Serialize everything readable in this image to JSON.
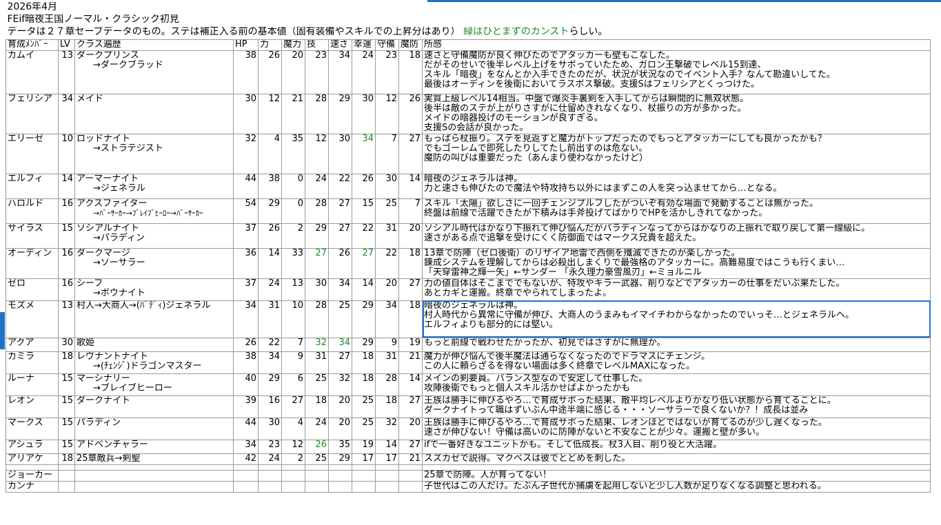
{
  "sheet": {
    "date": "2026年4月",
    "title": "FEif暗夜王国ノーマル・クラシック初見",
    "note_main": "データは２７章セーブデータのもの。ステは補正入る前の基本値（固有装備やスキルでの上昇分はあり）",
    "note_green": "緑はひとまずのカンスト",
    "note_tail": "らしい。"
  },
  "headers": [
    "育成ﾒﾝﾊﾞｰ",
    "LV",
    "クラス遍歴",
    "HP",
    "力",
    "魔力",
    "技",
    "速さ",
    "幸運",
    "守備",
    "魔防",
    "所感"
  ],
  "rows": [
    {
      "name": "カムイ",
      "lv": "13",
      "cls1": "ダークプリンス",
      "cls2": "→ダークブラッド",
      "stats": [
        "38",
        "26",
        "20",
        "23",
        "34",
        "24",
        "23",
        "18"
      ],
      "green": [],
      "comment": [
        "速さと守備魔防が良く伸びたのでアタッカーも壁もこなした。",
        "だがそのせいで後半レベル上げをサボっていたため、ガロン王撃破でレベル15到達、",
        "スキル「暗夜」をなんとか入手できたのだが、状況が状況なのでイベント入手？なんて勘違いしてた。",
        "最後はオーディンを後衛においてラスボス撃破。支援Sはフェリシアとくっつけた。"
      ]
    },
    {
      "name": "フェリシア",
      "lv": "34",
      "cls1": "メイド",
      "cls2": "",
      "stats": [
        "30",
        "12",
        "21",
        "28",
        "29",
        "30",
        "12",
        "26"
      ],
      "green": [],
      "comment": [
        "実質上級レベル14相当。中盤で爆炎手裏剣を入手してからは瞬間的に無双状態。",
        "後半は敵のステが上がりさすがに仕留めきれなくなり、杖振りの方が多かった。",
        "メイドの暗器投げのモーションが良すぎる。",
        "支援Sの会話が良かった。"
      ]
    },
    {
      "name": "エリーゼ",
      "lv": "10",
      "cls1": "ロッドナイト",
      "cls2": "→ストラテジスト",
      "stats": [
        "32",
        "4",
        "35",
        "12",
        "30",
        "34",
        "7",
        "27"
      ],
      "green": [
        5
      ],
      "comment": [
        "もっぱら杖振り。ステを見返すと魔力がトップだったのでもっとアタッカーにしても良かったかも？",
        "でもゴーレムで即死したりしてたし前出すのは危ない。",
        "魔防の叫びは重要だった（あんまり使わなかったけど）"
      ]
    },
    {
      "name": "エルフィ",
      "lv": "14",
      "cls1": "アーマーナイト",
      "cls2": "→ジェネラル",
      "stats": [
        "44",
        "38",
        "0",
        "24",
        "22",
        "26",
        "30",
        "14"
      ],
      "green": [],
      "comment": [
        "暗夜のジェネラルは神。",
        "力と速さも伸びたので魔法や特攻持ち以外にはまずこの人を突っ込ませてから…となる。"
      ]
    },
    {
      "name": "ハロルド",
      "lv": "16",
      "cls1": "アクスファイター",
      "cls2": "→ﾊﾞｰｻｰｶｰ→ﾌﾞﾚｲﾌﾞﾋｰﾛｰ→ﾊﾞｰｻｰｶｰ",
      "cls2small": true,
      "stats": [
        "54",
        "29",
        "0",
        "28",
        "27",
        "15",
        "25",
        "7"
      ],
      "green": [],
      "comment": [
        "スキル「太陽」欲しさに一回チェンジプルフしたがついぞ有効な場面で発動することは無かった。",
        "終盤は前線で活躍できたが下積みは手斧投げてばかりでHPを活かしきれてなかった。"
      ]
    },
    {
      "name": "サイラス",
      "lv": "15",
      "cls1": "ソシアルナイト",
      "cls2": "→パラディン",
      "stats": [
        "37",
        "26",
        "2",
        "29",
        "27",
        "22",
        "31",
        "20"
      ],
      "green": [],
      "comment": [
        "ソシアル時代はかなり下振れて伸び悩んだがパラディンなってからはかなりの上振れで取り戻して第一線級に。",
        "速さがある点で追撃を受けにくく防御面ではマークス兄貴を超えた。"
      ]
    },
    {
      "name": "オーディン",
      "lv": "16",
      "cls1": "ダークマージ",
      "cls2": "→ソーサラー",
      "stats": [
        "36",
        "14",
        "33",
        "27",
        "26",
        "27",
        "22",
        "18"
      ],
      "green": [
        3,
        5
      ],
      "comment": [
        "13章で防陣（ゼロ後衛）のリザイア地雷で西側を殲滅できたのが楽しかった。",
        "錬成システムを理解してからは必殺出しまくりで最強格のアタッカーに。高難易度ではこうも行くまい…",
        "「天穿雷神之輝一矢」←サンダー 「永久理力豪雪風刃」←ミョルニル"
      ]
    },
    {
      "name": "ゼロ",
      "lv": "16",
      "cls1": "シーフ",
      "cls2": "→ボウナイト",
      "stats": [
        "37",
        "24",
        "13",
        "30",
        "34",
        "14",
        "20",
        "27"
      ],
      "green": [],
      "comment": [
        "力の値自体はそこまででもないが、特攻やキラー武器、削りなどでアタッカーの仕事をだいぶ果たした。",
        "あとカギと運搬。終章でやられてしまったよ。"
      ]
    },
    {
      "name": "モズメ",
      "lv": "13",
      "cls1": "村人→大商人→(ﾊﾞﾃﾞｨ)ジェネラル",
      "cls2": "",
      "stats": [
        "34",
        "31",
        "10",
        "28",
        "25",
        "29",
        "34",
        "18"
      ],
      "green": [],
      "selected": true,
      "comment": [
        "暗夜のジェネラルは神。",
        "村人時代から異常に守備が伸び、大商人のうまみもイマイチわからなかったのでいっそ…とジェネラルへ。",
        "エルフィよりも部分的には堅い。"
      ]
    },
    {
      "name": "アクア",
      "lv": "30",
      "cls1": "歌姫",
      "cls2": "",
      "stats": [
        "26",
        "22",
        "7",
        "32",
        "34",
        "29",
        "9",
        "19"
      ],
      "green": [
        3,
        4
      ],
      "comment": [
        "もっと前線で戦わせたかったが、初見ではさすがに無理か。"
      ]
    },
    {
      "name": "カミラ",
      "lv": "18",
      "cls1": "レヴナントナイト",
      "cls2": "→(ﾁｪﾝｼﾞ)ドラゴンマスター",
      "stats": [
        "38",
        "34",
        "9",
        "31",
        "27",
        "18",
        "31",
        "21"
      ],
      "green": [],
      "comment": [
        "魔力が伸び悩んで後半魔法は通らなくなったのでドラマスにチェンジ。",
        "この人に頼らざるを得ない場面は多く終章でレベルMAXになった。"
      ]
    },
    {
      "name": "ルーナ",
      "lv": "15",
      "cls1": "マーシナリー",
      "cls2": "→ブレイブヒーロー",
      "stats": [
        "40",
        "29",
        "6",
        "25",
        "32",
        "18",
        "28",
        "14"
      ],
      "green": [],
      "comment": [
        "メインの剣要員。バランス型なので安定して仕事した。",
        "攻陣後衛でもっと個人スキル活かせばよかったかも"
      ]
    },
    {
      "name": "レオン",
      "lv": "15",
      "cls1": "ダークナイト",
      "cls2": "",
      "stats": [
        "39",
        "16",
        "27",
        "18",
        "20",
        "25",
        "18",
        "27"
      ],
      "green": [],
      "comment": [
        "王族は勝手に伸びるやろ…で育成サボった結果、敵平均レベルよりかなり低い状態から育てることに。",
        "ダークナイトって職はずいぶん中途半端に感じる・・・ソーサラーで良くないか？！成長は並み"
      ]
    },
    {
      "name": "マークス",
      "lv": "15",
      "cls1": "パラディン",
      "cls2": "",
      "stats": [
        "44",
        "30",
        "4",
        "24",
        "20",
        "25",
        "32",
        "20"
      ],
      "green": [],
      "comment": [
        "王族は勝手に伸びるやろ…で育成サボった結果、レオンほどではないが育てるのが少し遅くなった。",
        "速さが伸びない！守備は高いのに防陣がないと不安なことが少々。運搬と壁が多い。"
      ]
    },
    {
      "name": "アシュラ",
      "lv": "15",
      "cls1": "アドベンチャラー",
      "cls2": "",
      "stats": [
        "34",
        "23",
        "12",
        "26",
        "35",
        "19",
        "14",
        "27"
      ],
      "green": [
        3
      ],
      "comment": [
        "ifで一番好きなユニットかも。そして低成長。杖3人目、削り役と大活躍。"
      ]
    },
    {
      "name": "アリアケ",
      "lv": "18",
      "cls1": "25章敵兵→剣聖",
      "cls2": "",
      "stats": [
        "42",
        "24",
        "2",
        "25",
        "29",
        "17",
        "17",
        "21"
      ],
      "green": [],
      "comment": [
        "スズカゼで説得。マクベスは彼でとどめを刺した。"
      ]
    },
    {
      "name": "",
      "lv": "",
      "cls1": "",
      "cls2": "",
      "stats": [
        "",
        "",
        "",
        "",
        "",
        "",
        "",
        ""
      ],
      "green": [],
      "comment": [
        ""
      ]
    },
    {
      "name": "ジョーカー",
      "lv": "",
      "cls1": "",
      "cls2": "",
      "stats": [
        "",
        "",
        "",
        "",
        "",
        "",
        "",
        ""
      ],
      "green": [],
      "comment": [
        "25章で防陣。人が育ってない！"
      ]
    },
    {
      "name": "カンナ",
      "lv": "",
      "cls1": "",
      "cls2": "",
      "stats": [
        "",
        "",
        "",
        "",
        "",
        "",
        "",
        ""
      ],
      "green": [],
      "comment": [
        "子世代はこの人だけ。たぶん子世代か捕虜を起用しないと少し人数が足りなくなる調整と思われる。"
      ]
    }
  ]
}
